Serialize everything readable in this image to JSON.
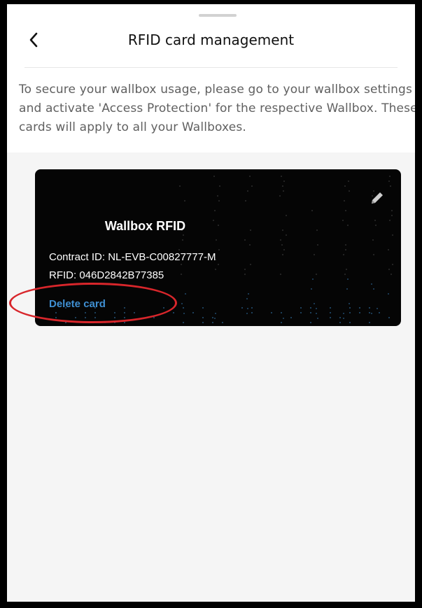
{
  "header": {
    "title": "RFID card management",
    "back_icon": "chevron-left-icon"
  },
  "description": "To secure your wallbox usage, please go to your wallbox settings and activate 'Access Protection' for the respective Wallbox. These cards will apply to all your Wallboxes.",
  "card": {
    "name": "Wallbox RFID",
    "contract_id": "Contract ID: NL-EVB-C00827777-M",
    "rfid": "RFID: 046D2842B77385",
    "delete_label": "Delete card",
    "edit_icon": "pencil-icon"
  },
  "colors": {
    "card_background": "#050505",
    "link": "#3f8fd2",
    "annotation": "#d8262b",
    "page_background": "#f5f5f5"
  }
}
